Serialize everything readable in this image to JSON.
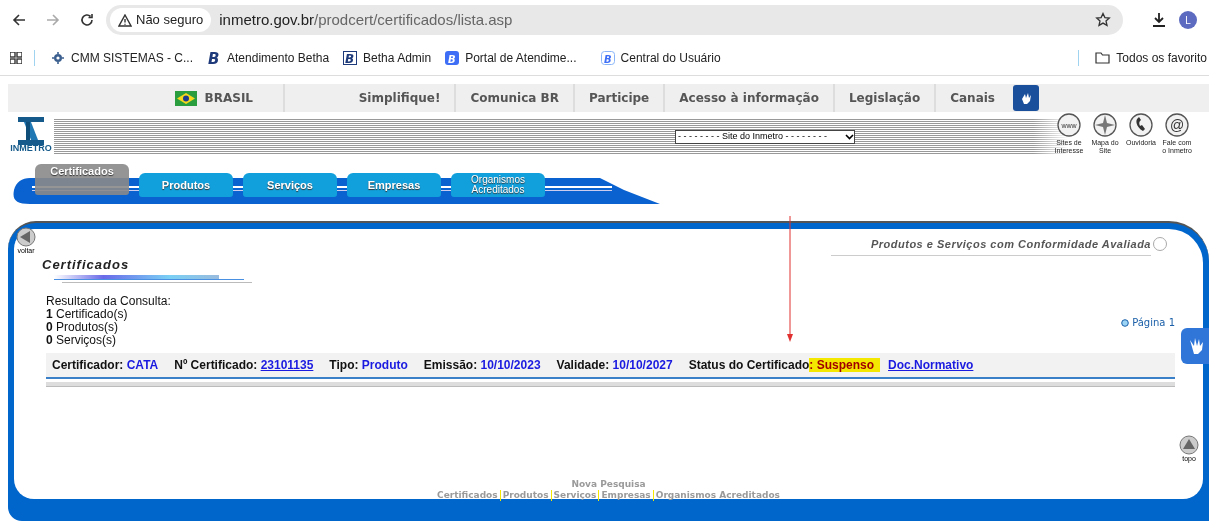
{
  "browser": {
    "security": "Não seguro",
    "url_host": "inmetro.gov.br",
    "url_path": "/prodcert/certificados/lista.asp",
    "avatar": "L",
    "bookmarks": [
      {
        "label": "CMM SISTEMAS - C...",
        "kind": "gear"
      },
      {
        "label": "Atendimento Betha",
        "kind": "b-plain",
        "glyph": "B"
      },
      {
        "label": "Betha Admin",
        "kind": "b-box",
        "glyph": "B"
      },
      {
        "label": "Portal de Atendime...",
        "kind": "b-blue",
        "glyph": "B"
      },
      {
        "label": "Central do Usuário",
        "kind": "b-outline",
        "glyph": "B"
      }
    ],
    "all_bookmarks": "Todos os favorito"
  },
  "gov_bar": {
    "country": "BRASIL",
    "links": [
      "Simplifique!",
      "Comunica BR",
      "Participe",
      "Acesso à informação",
      "Legislação",
      "Canais"
    ]
  },
  "header": {
    "logo": "INMETRO",
    "site_select": "- - - - - - - - Site do Inmetro - - - - - - - -",
    "shortcuts": [
      {
        "label": "Sites de Interesse",
        "glyph": "www"
      },
      {
        "label": "Mapa do Site"
      },
      {
        "label": "Ouvidoria"
      },
      {
        "label": "Fale com o Inmetro",
        "glyph": "@"
      }
    ]
  },
  "tabs": [
    {
      "label": "Certificados",
      "selected": true
    },
    {
      "label": "Produtos",
      "selected": false
    },
    {
      "label": "Serviços",
      "selected": false
    },
    {
      "label": "Empresas",
      "selected": false
    },
    {
      "label": "Organismos Acreditados",
      "selected": false
    }
  ],
  "content": {
    "back": "voltar",
    "heading": "Certificados",
    "subtitle": "Produtos e Serviços com Conformidade Avaliada",
    "summary_title": "Resultado da Consulta:",
    "counts": [
      {
        "count": "1",
        "label": "Certificado(s)"
      },
      {
        "count": "0",
        "label": "Produtos(s)"
      },
      {
        "count": "0",
        "label": "Serviços(s)"
      }
    ],
    "page": "Página 1",
    "record": [
      {
        "label": "Certificador:",
        "value": "CATA",
        "kind": "text"
      },
      {
        "label": "Nº Certificado:",
        "value": "23101135",
        "kind": "link"
      },
      {
        "label": "Tipo:",
        "value": "Produto",
        "kind": "text"
      },
      {
        "label": "Emissão:",
        "value": "10/10/2023",
        "kind": "text"
      },
      {
        "label": "Validade:",
        "value": "10/10/2027",
        "kind": "text"
      },
      {
        "label": "Status do Certificado",
        "value": ": Suspenso",
        "kind": "highlight"
      }
    ],
    "doc_link": "Doc.Normativo",
    "top": "topo",
    "footer_title": "Nova Pesquisa",
    "footer_links": [
      "Certificados",
      "Produtos",
      "Serviços",
      "Empresas",
      "Organismos Acreditados"
    ]
  }
}
